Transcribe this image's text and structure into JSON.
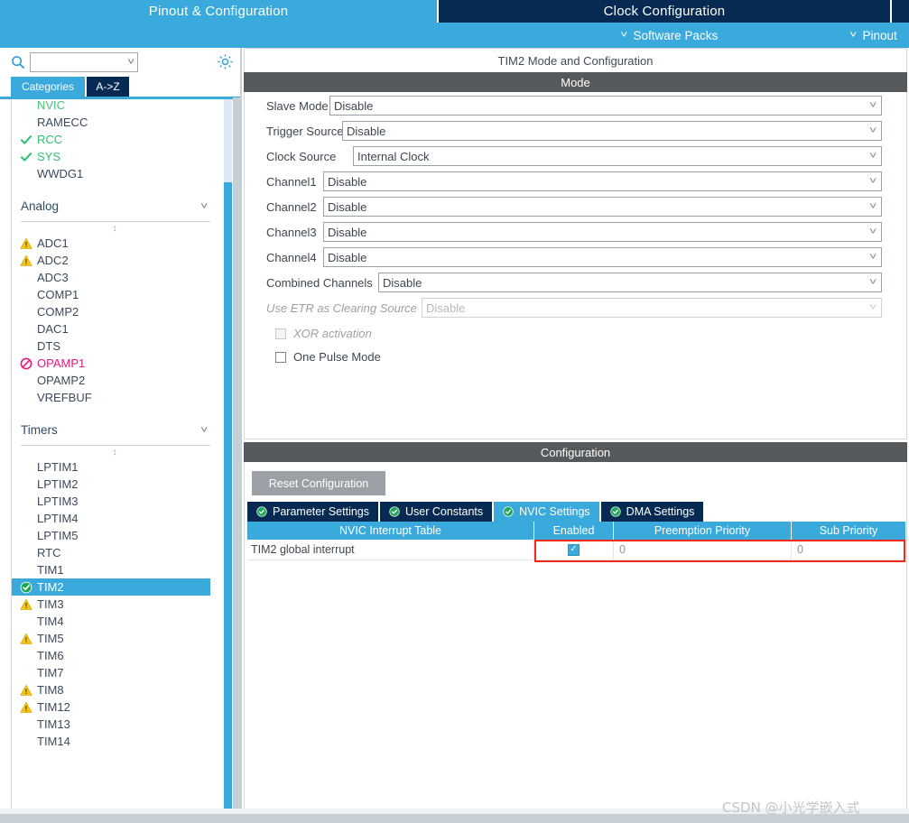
{
  "topbar": {
    "tabs": [
      {
        "label": "Pinout & Configuration",
        "active": true
      },
      {
        "label": "Clock Configuration",
        "active": false
      }
    ]
  },
  "subbar": {
    "software_packs": "Software Packs",
    "pinout": "Pinout"
  },
  "sidebar": {
    "search_placeholder": "",
    "search_value": "",
    "gear_icon": "gear-icon",
    "search_icon": "search-icon",
    "tabs": [
      {
        "label": "Categories",
        "selected": true
      },
      {
        "label": "A->Z",
        "selected": false
      }
    ],
    "items_system": [
      {
        "label": "NVIC",
        "state": "configured"
      },
      {
        "label": "RAMECC",
        "state": "none"
      },
      {
        "label": "RCC",
        "state": "check"
      },
      {
        "label": "SYS",
        "state": "check"
      },
      {
        "label": "WWDG1",
        "state": "none"
      }
    ],
    "group_analog": "Analog",
    "items_analog": [
      {
        "label": "ADC1",
        "state": "warn"
      },
      {
        "label": "ADC2",
        "state": "warn"
      },
      {
        "label": "ADC3",
        "state": "none"
      },
      {
        "label": "COMP1",
        "state": "none"
      },
      {
        "label": "COMP2",
        "state": "none"
      },
      {
        "label": "DAC1",
        "state": "none"
      },
      {
        "label": "DTS",
        "state": "none"
      },
      {
        "label": "OPAMP1",
        "state": "error"
      },
      {
        "label": "OPAMP2",
        "state": "none"
      },
      {
        "label": "VREFBUF",
        "state": "none"
      }
    ],
    "group_timers": "Timers",
    "items_timers": [
      {
        "label": "LPTIM1",
        "state": "none"
      },
      {
        "label": "LPTIM2",
        "state": "none"
      },
      {
        "label": "LPTIM3",
        "state": "none"
      },
      {
        "label": "LPTIM4",
        "state": "none"
      },
      {
        "label": "LPTIM5",
        "state": "none"
      },
      {
        "label": "RTC",
        "state": "none"
      },
      {
        "label": "TIM1",
        "state": "none"
      },
      {
        "label": "TIM2",
        "state": "selected"
      },
      {
        "label": "TIM3",
        "state": "warn"
      },
      {
        "label": "TIM4",
        "state": "none"
      },
      {
        "label": "TIM5",
        "state": "warn"
      },
      {
        "label": "TIM6",
        "state": "none"
      },
      {
        "label": "TIM7",
        "state": "none"
      },
      {
        "label": "TIM8",
        "state": "warn"
      },
      {
        "label": "TIM12",
        "state": "warn"
      },
      {
        "label": "TIM13",
        "state": "none"
      },
      {
        "label": "TIM14",
        "state": "none"
      }
    ]
  },
  "panel": {
    "title": "TIM2 Mode and Configuration",
    "mode_header": "Mode",
    "config_header": "Configuration"
  },
  "mode": {
    "fields": [
      {
        "label": "Slave Mode",
        "value": "Disable",
        "disabled": false
      },
      {
        "label": "Trigger Source",
        "value": "Disable",
        "disabled": false
      },
      {
        "label": "Clock Source",
        "value": "Internal Clock",
        "disabled": false
      },
      {
        "label": "Channel1",
        "value": "Disable",
        "disabled": false
      },
      {
        "label": "Channel2",
        "value": "Disable",
        "disabled": false
      },
      {
        "label": "Channel3",
        "value": "Disable",
        "disabled": false
      },
      {
        "label": "Channel4",
        "value": "Disable",
        "disabled": false
      },
      {
        "label": "Combined Channels",
        "value": "Disable",
        "disabled": false
      },
      {
        "label": "Use ETR as Clearing Source",
        "value": "Disable",
        "disabled": true
      }
    ],
    "checkboxes": [
      {
        "label": "XOR activation",
        "checked": false,
        "disabled": true
      },
      {
        "label": "One Pulse Mode",
        "checked": false,
        "disabled": false
      }
    ]
  },
  "config": {
    "reset_button": "Reset Configuration",
    "tabs": [
      {
        "label": "Parameter Settings",
        "active": false
      },
      {
        "label": "User Constants",
        "active": false
      },
      {
        "label": "NVIC Settings",
        "active": true
      },
      {
        "label": "DMA Settings",
        "active": false
      }
    ],
    "table": {
      "columns": [
        "NVIC Interrupt Table",
        "Enabled",
        "Preemption Priority",
        "Sub Priority"
      ],
      "rows": [
        {
          "name": "TIM2 global interrupt",
          "enabled": true,
          "preemption": "0",
          "sub": "0"
        }
      ]
    }
  },
  "watermark": "CSDN @小光学嵌入式",
  "colors": {
    "accent_blue": "#3aa9dc",
    "dark_navy": "#062a51",
    "header_gray": "#55595c",
    "highlight_red": "#ee2a17",
    "green_ok": "#2fbf71",
    "warn_yellow": "#f5c518",
    "error_pink": "#e8177d"
  }
}
